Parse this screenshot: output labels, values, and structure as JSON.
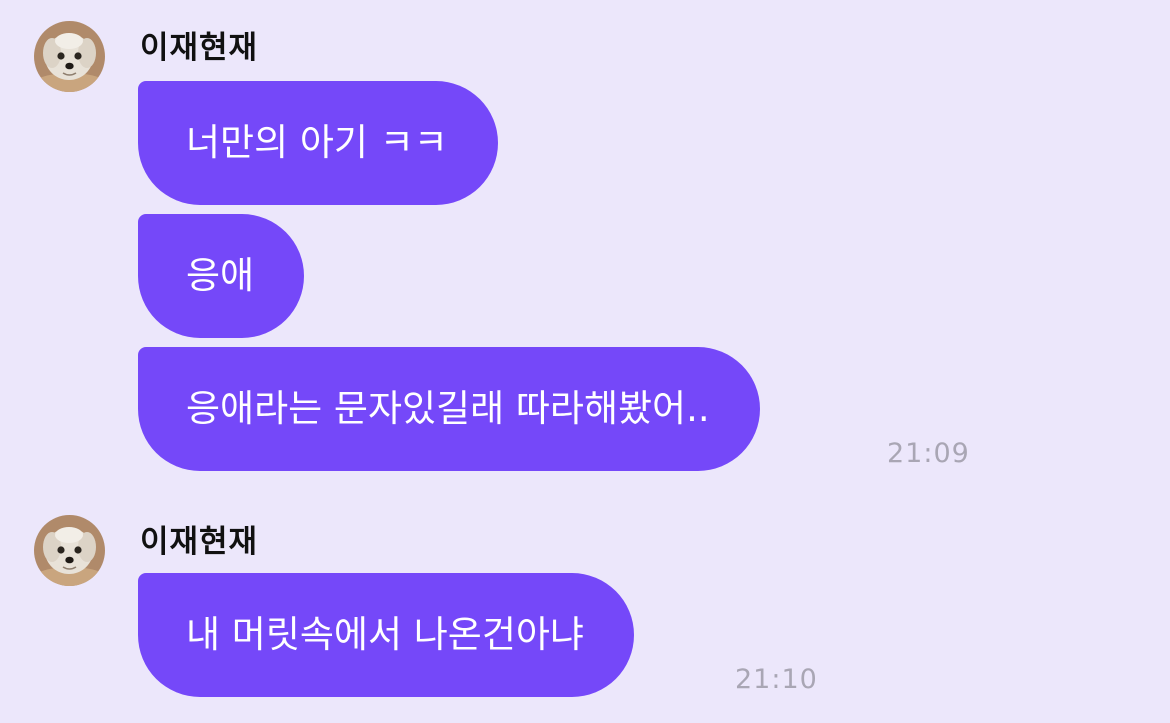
{
  "colors": {
    "background": "#ECE7FB",
    "bubble": "#7548F9",
    "bubble_text": "#FFFFFF",
    "sender_name": "#111111",
    "timestamp": "#A9A6B4"
  },
  "groups": [
    {
      "sender": "이재현재",
      "avatar_icon": "dog-avatar-icon",
      "messages": [
        {
          "text": "너만의 아기 ㅋㅋ"
        },
        {
          "text": "응애"
        },
        {
          "text": "응애라는 문자있길래 따라해봤어.."
        }
      ],
      "time": "21:09"
    },
    {
      "sender": "이재현재",
      "avatar_icon": "dog-avatar-icon",
      "messages": [
        {
          "text": "내 머릿속에서 나온건아냐"
        }
      ],
      "time": "21:10"
    }
  ]
}
